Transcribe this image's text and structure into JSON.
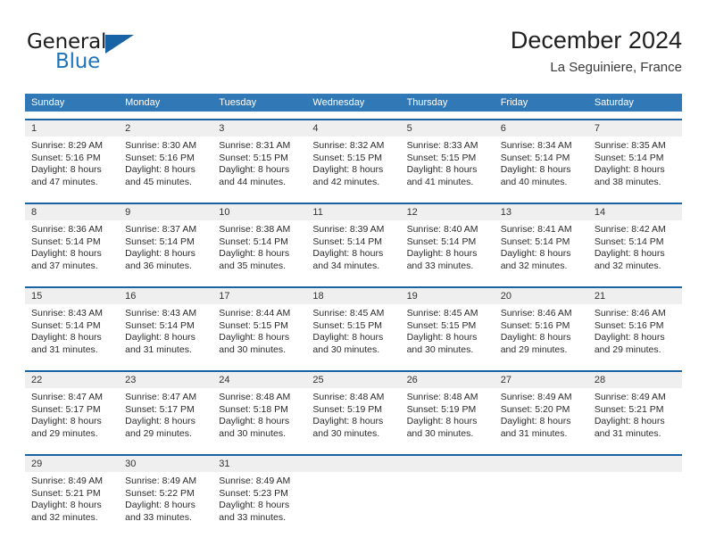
{
  "brand": {
    "name_part1": "General",
    "name_part2": "Blue",
    "triangle_color": "#1763a6"
  },
  "header": {
    "title": "December 2024",
    "subtitle": "La Seguiniere, France"
  },
  "theme": {
    "header_bar": "#3178b6",
    "week_rule": "#1763a6",
    "daynum_band": "#efefef",
    "text": "#2b2b2b"
  },
  "weekday_headers": [
    "Sunday",
    "Monday",
    "Tuesday",
    "Wednesday",
    "Thursday",
    "Friday",
    "Saturday"
  ],
  "weeks": [
    [
      {
        "day": "1",
        "sunrise": "Sunrise: 8:29 AM",
        "sunset": "Sunset: 5:16 PM",
        "daylight1": "Daylight: 8 hours",
        "daylight2": "and 47 minutes."
      },
      {
        "day": "2",
        "sunrise": "Sunrise: 8:30 AM",
        "sunset": "Sunset: 5:16 PM",
        "daylight1": "Daylight: 8 hours",
        "daylight2": "and 45 minutes."
      },
      {
        "day": "3",
        "sunrise": "Sunrise: 8:31 AM",
        "sunset": "Sunset: 5:15 PM",
        "daylight1": "Daylight: 8 hours",
        "daylight2": "and 44 minutes."
      },
      {
        "day": "4",
        "sunrise": "Sunrise: 8:32 AM",
        "sunset": "Sunset: 5:15 PM",
        "daylight1": "Daylight: 8 hours",
        "daylight2": "and 42 minutes."
      },
      {
        "day": "5",
        "sunrise": "Sunrise: 8:33 AM",
        "sunset": "Sunset: 5:15 PM",
        "daylight1": "Daylight: 8 hours",
        "daylight2": "and 41 minutes."
      },
      {
        "day": "6",
        "sunrise": "Sunrise: 8:34 AM",
        "sunset": "Sunset: 5:14 PM",
        "daylight1": "Daylight: 8 hours",
        "daylight2": "and 40 minutes."
      },
      {
        "day": "7",
        "sunrise": "Sunrise: 8:35 AM",
        "sunset": "Sunset: 5:14 PM",
        "daylight1": "Daylight: 8 hours",
        "daylight2": "and 38 minutes."
      }
    ],
    [
      {
        "day": "8",
        "sunrise": "Sunrise: 8:36 AM",
        "sunset": "Sunset: 5:14 PM",
        "daylight1": "Daylight: 8 hours",
        "daylight2": "and 37 minutes."
      },
      {
        "day": "9",
        "sunrise": "Sunrise: 8:37 AM",
        "sunset": "Sunset: 5:14 PM",
        "daylight1": "Daylight: 8 hours",
        "daylight2": "and 36 minutes."
      },
      {
        "day": "10",
        "sunrise": "Sunrise: 8:38 AM",
        "sunset": "Sunset: 5:14 PM",
        "daylight1": "Daylight: 8 hours",
        "daylight2": "and 35 minutes."
      },
      {
        "day": "11",
        "sunrise": "Sunrise: 8:39 AM",
        "sunset": "Sunset: 5:14 PM",
        "daylight1": "Daylight: 8 hours",
        "daylight2": "and 34 minutes."
      },
      {
        "day": "12",
        "sunrise": "Sunrise: 8:40 AM",
        "sunset": "Sunset: 5:14 PM",
        "daylight1": "Daylight: 8 hours",
        "daylight2": "and 33 minutes."
      },
      {
        "day": "13",
        "sunrise": "Sunrise: 8:41 AM",
        "sunset": "Sunset: 5:14 PM",
        "daylight1": "Daylight: 8 hours",
        "daylight2": "and 32 minutes."
      },
      {
        "day": "14",
        "sunrise": "Sunrise: 8:42 AM",
        "sunset": "Sunset: 5:14 PM",
        "daylight1": "Daylight: 8 hours",
        "daylight2": "and 32 minutes."
      }
    ],
    [
      {
        "day": "15",
        "sunrise": "Sunrise: 8:43 AM",
        "sunset": "Sunset: 5:14 PM",
        "daylight1": "Daylight: 8 hours",
        "daylight2": "and 31 minutes."
      },
      {
        "day": "16",
        "sunrise": "Sunrise: 8:43 AM",
        "sunset": "Sunset: 5:14 PM",
        "daylight1": "Daylight: 8 hours",
        "daylight2": "and 31 minutes."
      },
      {
        "day": "17",
        "sunrise": "Sunrise: 8:44 AM",
        "sunset": "Sunset: 5:15 PM",
        "daylight1": "Daylight: 8 hours",
        "daylight2": "and 30 minutes."
      },
      {
        "day": "18",
        "sunrise": "Sunrise: 8:45 AM",
        "sunset": "Sunset: 5:15 PM",
        "daylight1": "Daylight: 8 hours",
        "daylight2": "and 30 minutes."
      },
      {
        "day": "19",
        "sunrise": "Sunrise: 8:45 AM",
        "sunset": "Sunset: 5:15 PM",
        "daylight1": "Daylight: 8 hours",
        "daylight2": "and 30 minutes."
      },
      {
        "day": "20",
        "sunrise": "Sunrise: 8:46 AM",
        "sunset": "Sunset: 5:16 PM",
        "daylight1": "Daylight: 8 hours",
        "daylight2": "and 29 minutes."
      },
      {
        "day": "21",
        "sunrise": "Sunrise: 8:46 AM",
        "sunset": "Sunset: 5:16 PM",
        "daylight1": "Daylight: 8 hours",
        "daylight2": "and 29 minutes."
      }
    ],
    [
      {
        "day": "22",
        "sunrise": "Sunrise: 8:47 AM",
        "sunset": "Sunset: 5:17 PM",
        "daylight1": "Daylight: 8 hours",
        "daylight2": "and 29 minutes."
      },
      {
        "day": "23",
        "sunrise": "Sunrise: 8:47 AM",
        "sunset": "Sunset: 5:17 PM",
        "daylight1": "Daylight: 8 hours",
        "daylight2": "and 29 minutes."
      },
      {
        "day": "24",
        "sunrise": "Sunrise: 8:48 AM",
        "sunset": "Sunset: 5:18 PM",
        "daylight1": "Daylight: 8 hours",
        "daylight2": "and 30 minutes."
      },
      {
        "day": "25",
        "sunrise": "Sunrise: 8:48 AM",
        "sunset": "Sunset: 5:19 PM",
        "daylight1": "Daylight: 8 hours",
        "daylight2": "and 30 minutes."
      },
      {
        "day": "26",
        "sunrise": "Sunrise: 8:48 AM",
        "sunset": "Sunset: 5:19 PM",
        "daylight1": "Daylight: 8 hours",
        "daylight2": "and 30 minutes."
      },
      {
        "day": "27",
        "sunrise": "Sunrise: 8:49 AM",
        "sunset": "Sunset: 5:20 PM",
        "daylight1": "Daylight: 8 hours",
        "daylight2": "and 31 minutes."
      },
      {
        "day": "28",
        "sunrise": "Sunrise: 8:49 AM",
        "sunset": "Sunset: 5:21 PM",
        "daylight1": "Daylight: 8 hours",
        "daylight2": "and 31 minutes."
      }
    ],
    [
      {
        "day": "29",
        "sunrise": "Sunrise: 8:49 AM",
        "sunset": "Sunset: 5:21 PM",
        "daylight1": "Daylight: 8 hours",
        "daylight2": "and 32 minutes."
      },
      {
        "day": "30",
        "sunrise": "Sunrise: 8:49 AM",
        "sunset": "Sunset: 5:22 PM",
        "daylight1": "Daylight: 8 hours",
        "daylight2": "and 33 minutes."
      },
      {
        "day": "31",
        "sunrise": "Sunrise: 8:49 AM",
        "sunset": "Sunset: 5:23 PM",
        "daylight1": "Daylight: 8 hours",
        "daylight2": "and 33 minutes."
      },
      {
        "day": "",
        "sunrise": "",
        "sunset": "",
        "daylight1": "",
        "daylight2": ""
      },
      {
        "day": "",
        "sunrise": "",
        "sunset": "",
        "daylight1": "",
        "daylight2": ""
      },
      {
        "day": "",
        "sunrise": "",
        "sunset": "",
        "daylight1": "",
        "daylight2": ""
      },
      {
        "day": "",
        "sunrise": "",
        "sunset": "",
        "daylight1": "",
        "daylight2": ""
      }
    ]
  ]
}
